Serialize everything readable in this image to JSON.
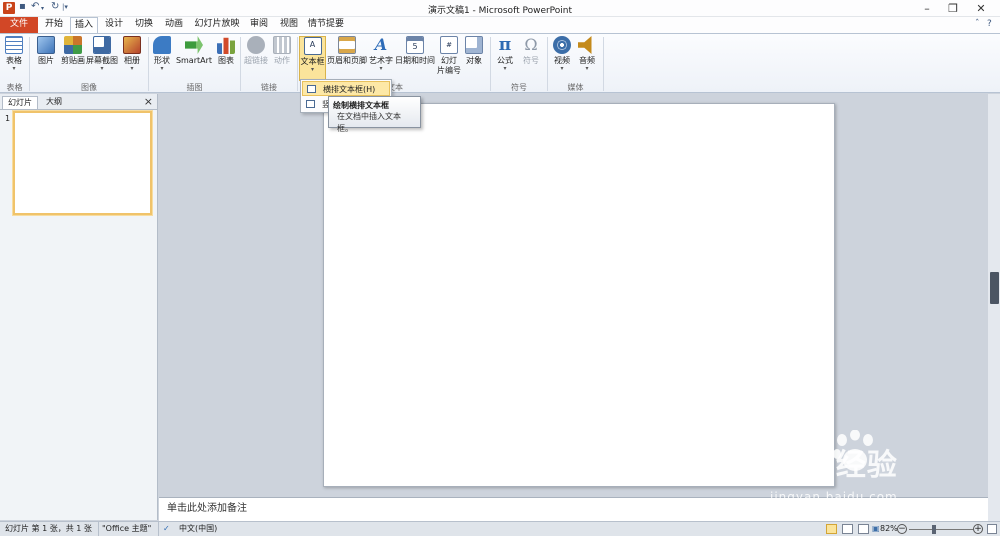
{
  "window": {
    "title": "演示文稿1 - Microsoft PowerPoint",
    "minimize_icon": "minimize-icon",
    "restore_icon": "restore-icon",
    "close_icon": "close-icon"
  },
  "tabs": [
    {
      "label": "文件"
    },
    {
      "label": "开始"
    },
    {
      "label": "插入"
    },
    {
      "label": "设计"
    },
    {
      "label": "切换"
    },
    {
      "label": "动画"
    },
    {
      "label": "幻灯片放映"
    },
    {
      "label": "审阅"
    },
    {
      "label": "视图"
    },
    {
      "label": "情节提要"
    }
  ],
  "ribbon": {
    "buttons": [
      {
        "label": "表格",
        "icon": "table-icon",
        "color": "#4f7fbf"
      },
      {
        "label": "图片",
        "icon": "picture-icon",
        "color": "#5a8fcf"
      },
      {
        "label": "剪贴画",
        "icon": "clipart-icon",
        "color": "#c9752b"
      },
      {
        "label": "屏幕截图",
        "icon": "screenshot-icon",
        "color": "#3f6aa3"
      },
      {
        "label": "相册",
        "icon": "album-icon",
        "color": "#b5432c"
      },
      {
        "label": "形状",
        "icon": "shapes-icon",
        "color": "#3c7bc4"
      },
      {
        "label": "SmartArt",
        "icon": "smartart-icon",
        "color": "#3d9b3d"
      },
      {
        "label": "图表",
        "icon": "chart-icon",
        "color": "#d14a2b"
      },
      {
        "label": "超链接",
        "icon": "hyperlink-icon",
        "color": "#a9b0ba"
      },
      {
        "label": "动作",
        "icon": "action-icon",
        "color": "#a9b0ba"
      },
      {
        "label": "文本框",
        "icon": "textbox-icon",
        "color": "#ffffff"
      },
      {
        "label": "页眉和页脚",
        "icon": "header-footer-icon",
        "color": "#d9a74a"
      },
      {
        "label": "艺术字",
        "icon": "wordart-icon",
        "color": "#2e6cb8"
      },
      {
        "label": "日期和时间",
        "icon": "date-time-icon",
        "color": "#6c84a8"
      },
      {
        "label": "幻灯",
        "label2": "片编号",
        "icon": "slide-number-icon",
        "color": "#6c84a8"
      },
      {
        "label": "对象",
        "icon": "object-icon",
        "color": "#6c84a8"
      },
      {
        "label": "公式",
        "icon": "equation-icon",
        "color": "#2f6bb3"
      },
      {
        "label": "符号",
        "icon": "symbol-icon",
        "color": "#8e99a8"
      },
      {
        "label": "视频",
        "icon": "video-icon",
        "color": "#3c6ea8"
      },
      {
        "label": "音频",
        "icon": "audio-icon",
        "color": "#c48a1b"
      }
    ],
    "groups": [
      "表格",
      "图像",
      "插图",
      "链接",
      "文本",
      "符号",
      "媒体"
    ]
  },
  "textbox_menu": {
    "items": [
      {
        "label": "横排文本框(H)"
      },
      {
        "label": "竖"
      }
    ]
  },
  "tooltip": {
    "title": "绘制横排文本框",
    "description": "在文档中插入文本框。"
  },
  "slides_panel": {
    "tabs": [
      "幻灯片",
      "大纲"
    ],
    "close": "×",
    "slides": [
      {
        "number": "1"
      }
    ]
  },
  "notes": {
    "placeholder": "单击此处添加备注"
  },
  "statusbar": {
    "slide_info": "幻灯片 第 1 张，共 1 张",
    "theme": "\"Office 主题\"",
    "language": "中文(中国)",
    "zoom": "82%",
    "minus": "−",
    "plus": "+"
  },
  "watermark": {
    "brand": "Bai  经验",
    "url": "jingyan.baidu.com"
  }
}
